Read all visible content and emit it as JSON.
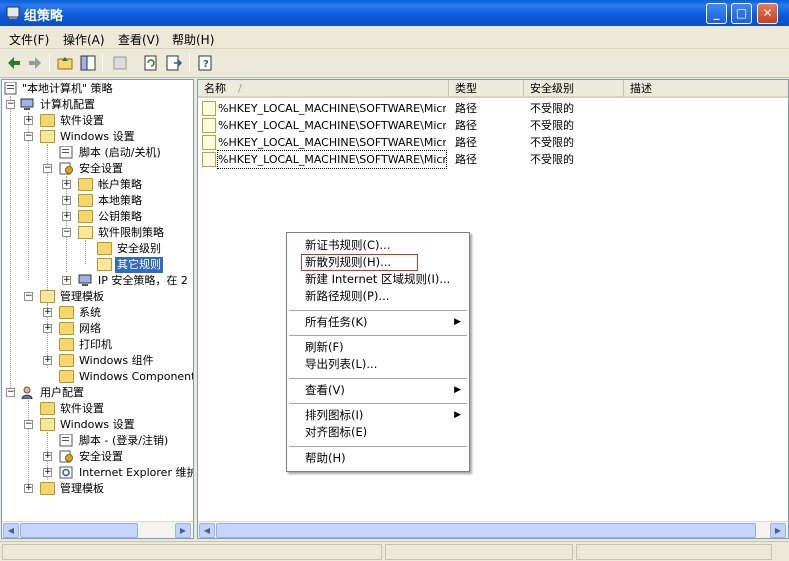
{
  "window": {
    "title": "组策略"
  },
  "menu": [
    {
      "label": "文件(F)"
    },
    {
      "label": "操作(A)"
    },
    {
      "label": "查看(V)"
    },
    {
      "label": "帮助(H)"
    }
  ],
  "toolbar": {
    "buttons": [
      "back-arrow-icon",
      "forward-arrow-icon",
      "up-folder-icon",
      "show-hide-tree-icon",
      "delete-icon",
      "refresh-icon",
      "export-list-icon",
      "help-icon"
    ]
  },
  "tree": {
    "root": "\"本地计算机\" 策略",
    "nodes": [
      {
        "label": "计算机配置"
      },
      {
        "label": "软件设置"
      },
      {
        "label": "Windows 设置"
      },
      {
        "label": "脚本 (启动/关机)"
      },
      {
        "label": "安全设置"
      },
      {
        "label": "帐户策略"
      },
      {
        "label": "本地策略"
      },
      {
        "label": "公钥策略"
      },
      {
        "label": "软件限制策略"
      },
      {
        "label": "安全级别"
      },
      {
        "label": "其它规则"
      },
      {
        "label": "IP 安全策略，在 2"
      },
      {
        "label": "管理模板"
      },
      {
        "label": "系统"
      },
      {
        "label": "网络"
      },
      {
        "label": "打印机"
      },
      {
        "label": "Windows 组件"
      },
      {
        "label": "Windows Components"
      },
      {
        "label": "用户配置"
      },
      {
        "label": "软件设置"
      },
      {
        "label": "Windows 设置"
      },
      {
        "label": "脚本 - (登录/注销)"
      },
      {
        "label": "安全设置"
      },
      {
        "label": "Internet Explorer 维护"
      },
      {
        "label": "管理模板"
      }
    ]
  },
  "list": {
    "columns": [
      "名称",
      "类型",
      "安全级别",
      "描述"
    ],
    "sort_indicator": "/",
    "rows": [
      {
        "name": "%HKEY_LOCAL_MACHINE\\SOFTWARE\\Micro...",
        "type": "路径",
        "level": "不受限的",
        "desc": ""
      },
      {
        "name": "%HKEY_LOCAL_MACHINE\\SOFTWARE\\Micro...",
        "type": "路径",
        "level": "不受限的",
        "desc": ""
      },
      {
        "name": "%HKEY_LOCAL_MACHINE\\SOFTWARE\\Micro...",
        "type": "路径",
        "level": "不受限的",
        "desc": ""
      },
      {
        "name": "%HKEY_LOCAL_MACHINE\\SOFTWARE\\Micro...",
        "type": "路径",
        "level": "不受限的",
        "desc": ""
      }
    ]
  },
  "context_menu": {
    "items": [
      {
        "label": "新证书规则(C)..."
      },
      {
        "label": "新散列规则(H)..."
      },
      {
        "label": "新建 Internet 区域规则(I)..."
      },
      {
        "label": "新路径规则(P)..."
      },
      {
        "label": "所有任务(K)"
      },
      {
        "label": "刷新(F)"
      },
      {
        "label": "导出列表(L)..."
      },
      {
        "label": "查看(V)"
      },
      {
        "label": "排列图标(I)"
      },
      {
        "label": "对齐图标(E)"
      },
      {
        "label": "帮助(H)"
      }
    ],
    "submenu_arrow": "▶"
  },
  "colors": {
    "titlebar": "#0a5fd8",
    "selection": "#316ac5",
    "highlight_box": "#c0392b"
  }
}
